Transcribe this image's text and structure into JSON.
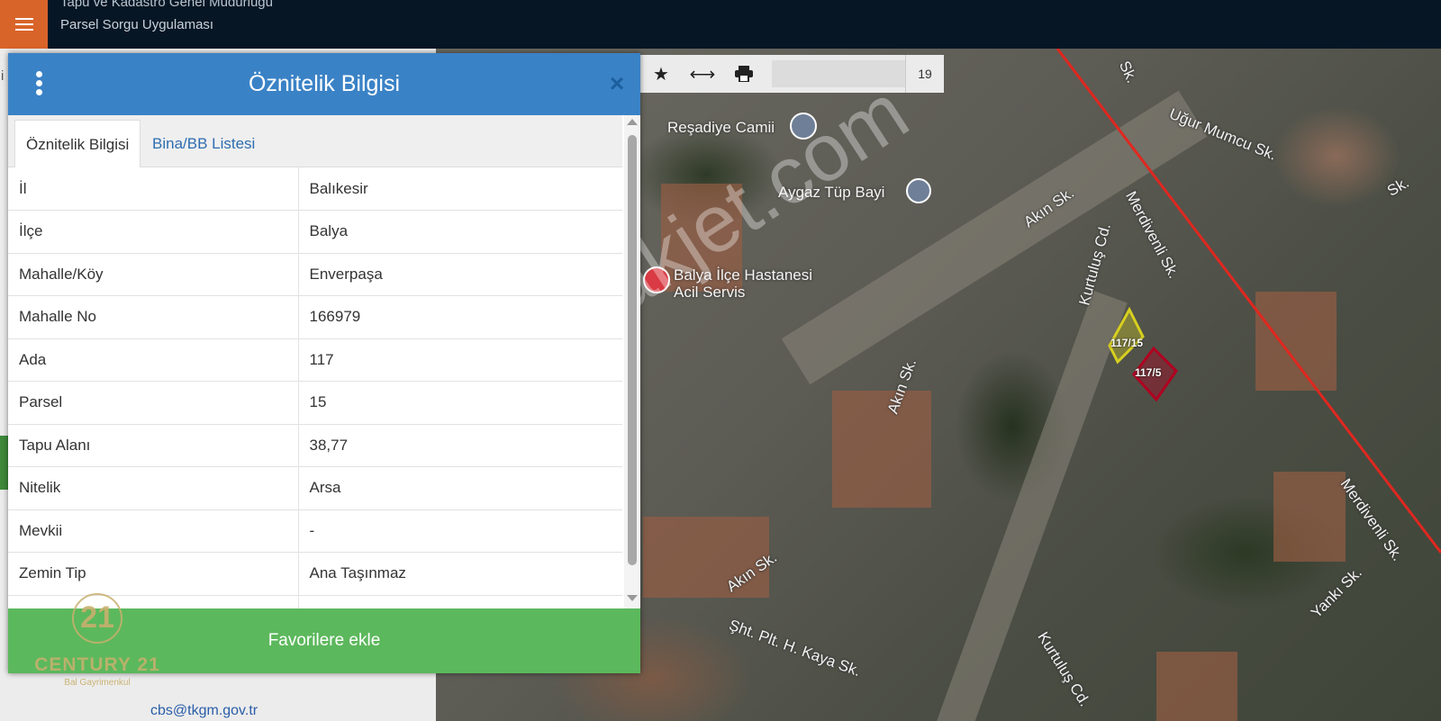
{
  "app": {
    "title_line1": "Tapu ve Kadastro Genel Müdürlüğü",
    "title_line2": "Parsel Sorgu Uygulaması",
    "left_letter": "i",
    "contact_email": "cbs@tkgm.gov.tr"
  },
  "map": {
    "zoom_level": "19",
    "street_labels": [
      "Uğur Mumcu Sk.",
      "Akın Sk.",
      "Kurtuluş Cd.",
      "Merdivenli Sk.",
      "Akın Sk.",
      "Akın Sk.",
      "Şht. Plt. H. Kaya Sk.",
      "Kurtuluş Cd.",
      "Yankı Sk.",
      "Merdivenli Sk.",
      "Sk.",
      "Sk."
    ],
    "poi_labels": [
      "Reşadiye Camii",
      "Aygaz Tüp Bayi",
      "Balya İlçe Hastanesi",
      "Acil Servis"
    ],
    "parcel_labels": [
      "117/15",
      "117/5"
    ],
    "parcel_color": "#d8d01f",
    "selected_parcel_color": "#b00020",
    "boundary_color": "#e0271f",
    "watermark": "emlakjet.com"
  },
  "dialog": {
    "title": "Öznitelik Bilgisi",
    "close_symbol": "×",
    "tabs": [
      "Öznitelik Bilgisi",
      "Bina/BB Listesi"
    ],
    "rows": [
      {
        "key": "İl",
        "value": "Balıkesir"
      },
      {
        "key": "İlçe",
        "value": "Balya"
      },
      {
        "key": "Mahalle/Köy",
        "value": "Enverpaşa"
      },
      {
        "key": "Mahalle No",
        "value": "166979"
      },
      {
        "key": "Ada",
        "value": "117"
      },
      {
        "key": "Parsel",
        "value": "15"
      },
      {
        "key": "Tapu Alanı",
        "value": "38,77"
      },
      {
        "key": "Nitelik",
        "value": "Arsa"
      },
      {
        "key": "Mevkii",
        "value": "-"
      },
      {
        "key": "Zemin Tip",
        "value": "Ana Taşınmaz"
      }
    ],
    "favorite_button": "Favorilere ekle",
    "header_color": "#3a82c6",
    "button_color": "#5cb85c"
  },
  "branding": {
    "number": "21",
    "name": "CENTURY 21",
    "sub": "Bal Gayrimenkul"
  }
}
